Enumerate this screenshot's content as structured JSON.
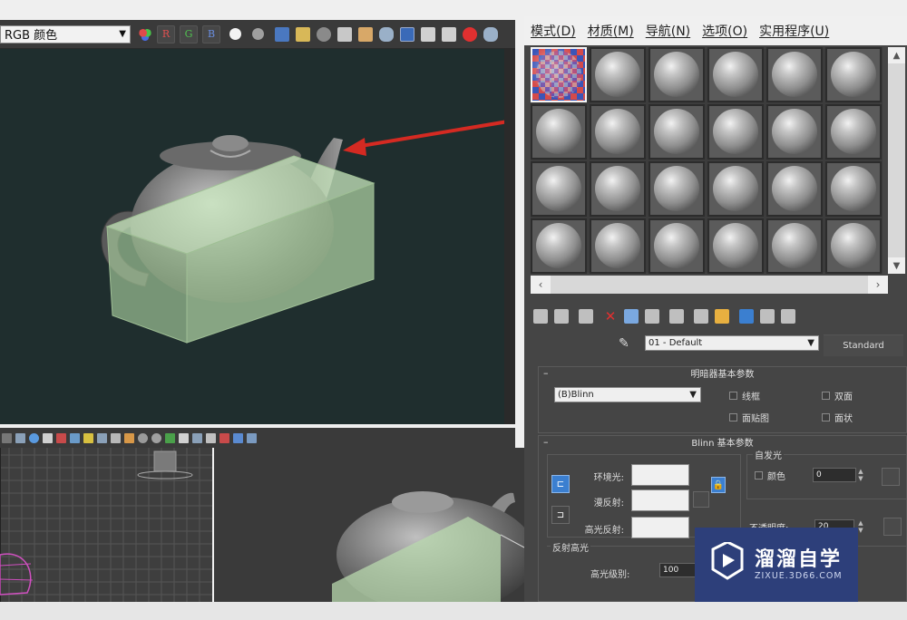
{
  "render_window": {
    "channel_display": "RGB 颜色",
    "channel_buttons": [
      "R",
      "G",
      "B"
    ]
  },
  "material_editor": {
    "menu": [
      "模式(D)",
      "材质(M)",
      "导航(N)",
      "选项(O)",
      "实用程序(U)"
    ],
    "material_name": "01 - Default",
    "material_type": "Standard",
    "shader_rollout": {
      "title": "明暗器基本参数",
      "shader": "(B)Blinn",
      "options": [
        "线框",
        "双面",
        "面贴图",
        "面状"
      ]
    },
    "blinn_rollout": {
      "title": "Blinn 基本参数",
      "self_illum_title": "自发光",
      "color_label": "颜色",
      "self_illum_value": "0",
      "ambient_label": "环境光:",
      "diffuse_label": "漫反射:",
      "specular_label": "高光反射:",
      "opacity_label": "不透明度:",
      "opacity_value": "20",
      "spec_highlights_title": "反射高光",
      "spec_level_label": "高光级别:",
      "spec_level_value": "100"
    }
  },
  "watermark": {
    "title": "溜溜自学",
    "subtitle": "ZIXUE.3D66.COM"
  },
  "colors": {
    "arrow": "#d42a22",
    "box_overlay": "#c9e8bf",
    "viewport_bg": "#1f2e2e",
    "selection_blue": "#3b7fd0"
  }
}
